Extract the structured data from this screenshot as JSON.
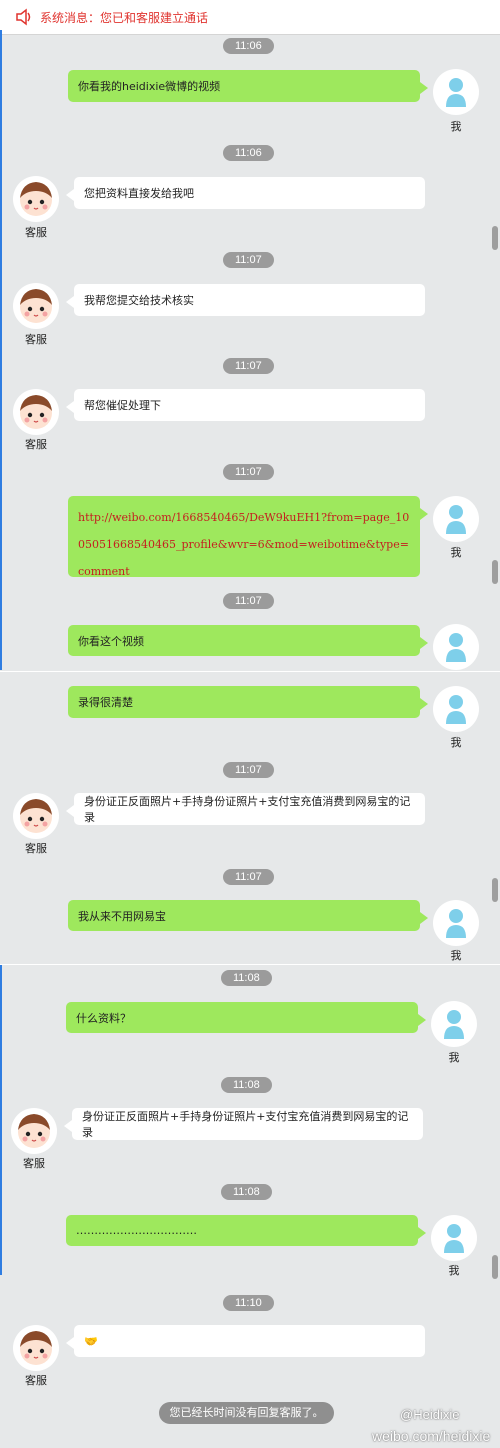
{
  "banner": {
    "text": "系统消息：您已和客服建立通话"
  },
  "labels": {
    "me": "我",
    "agent": "客服"
  },
  "times": [
    "11:06",
    "11:06",
    "11:07",
    "11:07",
    "11:07",
    "11:07",
    "11:07",
    "11:07",
    "11:08",
    "11:08",
    "11:08",
    "11:10"
  ],
  "messages": [
    "你看我的heidixie微博的视频",
    "您把资料直接发给我吧",
    "我帮您提交给技术核实",
    "帮您催促处理下",
    "http://weibo.com/1668540465/DeW9kuEH1?from=page_1005051668540465_profile&wvr=6&mod=weibotime&type=comment",
    "你看这个视频",
    "录得很清楚",
    "身份证正反面照片+手持身份证照片+支付宝充值消费到网易宝的记录",
    "我从来不用网易宝",
    "什么资料？",
    "身份证正反面照片+手持身份证照片+支付宝充值消费到网易宝的记录",
    "……………………………",
    "🤝"
  ],
  "footer_notice": "您已经长时间没有回复客服了。",
  "watermark": {
    "line1": "@Heidixie",
    "line2": "weibo.com/heidixie"
  },
  "colors": {
    "me_bubble": "#9ee85d",
    "agent_bubble": "#ffffff",
    "time_pill": "#9b9b9b",
    "banner_text": "#e0342f"
  }
}
